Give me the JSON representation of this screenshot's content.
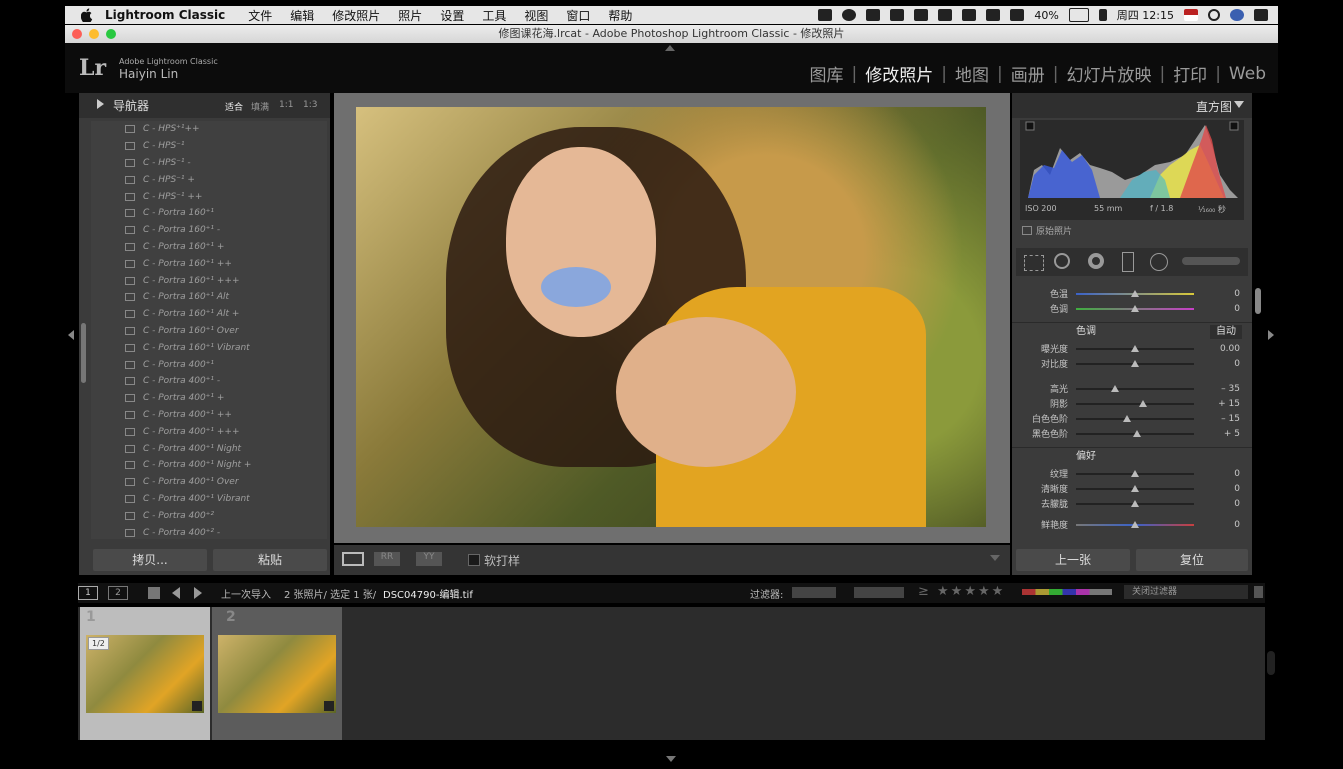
{
  "menubar": {
    "app_name": "Lightroom Classic",
    "items": [
      "文件",
      "编辑",
      "修改照片",
      "照片",
      "设置",
      "工具",
      "视图",
      "窗口",
      "帮助"
    ],
    "battery": "40%",
    "clock": "周四 12:15"
  },
  "window": {
    "title": "修图课花海.lrcat - Adobe Photoshop Lightroom Classic - 修改照片"
  },
  "identity": {
    "logo": "Lr",
    "product": "Adobe Lightroom Classic",
    "user": "Haiyin Lin"
  },
  "modules": [
    "图库",
    "修改照片",
    "地图",
    "画册",
    "幻灯片放映",
    "打印",
    "Web"
  ],
  "active_module": "修改照片",
  "navigator": {
    "title": "导航器",
    "zoom_options": [
      "适合",
      "填满",
      "1:1",
      "1:3"
    ]
  },
  "presets": [
    "C - HPS⁺¹++",
    "C - HPS⁻¹",
    "C - HPS⁻¹ -",
    "C - HPS⁻¹ +",
    "C - HPS⁻¹ ++",
    "C - Portra 160⁺¹",
    "C - Portra 160⁺¹ -",
    "C - Portra 160⁺¹ +",
    "C - Portra 160⁺¹ ++",
    "C - Portra 160⁺¹ +++",
    "C - Portra 160⁺¹ Alt",
    "C - Portra 160⁺¹ Alt +",
    "C - Portra 160⁺¹ Over",
    "C - Portra 160⁺¹ Vibrant",
    "C - Portra 400⁺¹",
    "C - Portra 400⁺¹ -",
    "C - Portra 400⁺¹ +",
    "C - Portra 400⁺¹ ++",
    "C - Portra 400⁺¹ +++",
    "C - Portra 400⁺¹ Night",
    "C - Portra 400⁺¹ Night +",
    "C - Portra 400⁺¹ Over",
    "C - Portra 400⁺¹ Vibrant",
    "C - Portra 400⁺²",
    "C - Portra 400⁺² -"
  ],
  "left_buttons": {
    "copy": "拷贝...",
    "paste": "粘贴"
  },
  "toolbar": {
    "soft_proof": "软打样"
  },
  "histogram": {
    "title": "直方图",
    "iso": "ISO 200",
    "focal": "55 mm",
    "aperture": "f / 1.8",
    "shutter": "¹⁄₁₆₀₀ 秒",
    "original_photo": "原始照片"
  },
  "sliders_top": [
    {
      "label": "色温",
      "value": "0",
      "pos": 0.5
    },
    {
      "label": "色调",
      "value": "0",
      "pos": 0.5
    }
  ],
  "tone": {
    "title": "色调",
    "auto": "自动",
    "sliders": [
      {
        "label": "曝光度",
        "value": "0.00",
        "pos": 0.5
      },
      {
        "label": "对比度",
        "value": "0",
        "pos": 0.5
      },
      {
        "label": "高光",
        "value": "– 35",
        "pos": 0.33
      },
      {
        "label": "阴影",
        "value": "+ 15",
        "pos": 0.57
      },
      {
        "label": "白色色阶",
        "value": "– 15",
        "pos": 0.43
      },
      {
        "label": "黑色色阶",
        "value": "+ 5",
        "pos": 0.52
      }
    ]
  },
  "presence": {
    "title": "偏好",
    "sliders": [
      {
        "label": "纹理",
        "value": "0",
        "pos": 0.5
      },
      {
        "label": "清晰度",
        "value": "0",
        "pos": 0.5
      },
      {
        "label": "去朦胧",
        "value": "0",
        "pos": 0.5
      },
      {
        "label": "鲜艳度",
        "value": "0",
        "pos": 0.5
      }
    ]
  },
  "right_buttons": {
    "previous": "上一张",
    "reset": "复位"
  },
  "filmstrip_bar": {
    "page1": "1",
    "page2": "2",
    "source": "上一次导入",
    "count": "2 张照片/ 选定 1 张/",
    "filename": "DSC04790-编辑.tif",
    "filter_label": "过滤器:",
    "filter_value": "关闭过滤器"
  },
  "thumbs": [
    {
      "num": "1",
      "badge": "1/2"
    },
    {
      "num": "2",
      "badge": ""
    }
  ]
}
